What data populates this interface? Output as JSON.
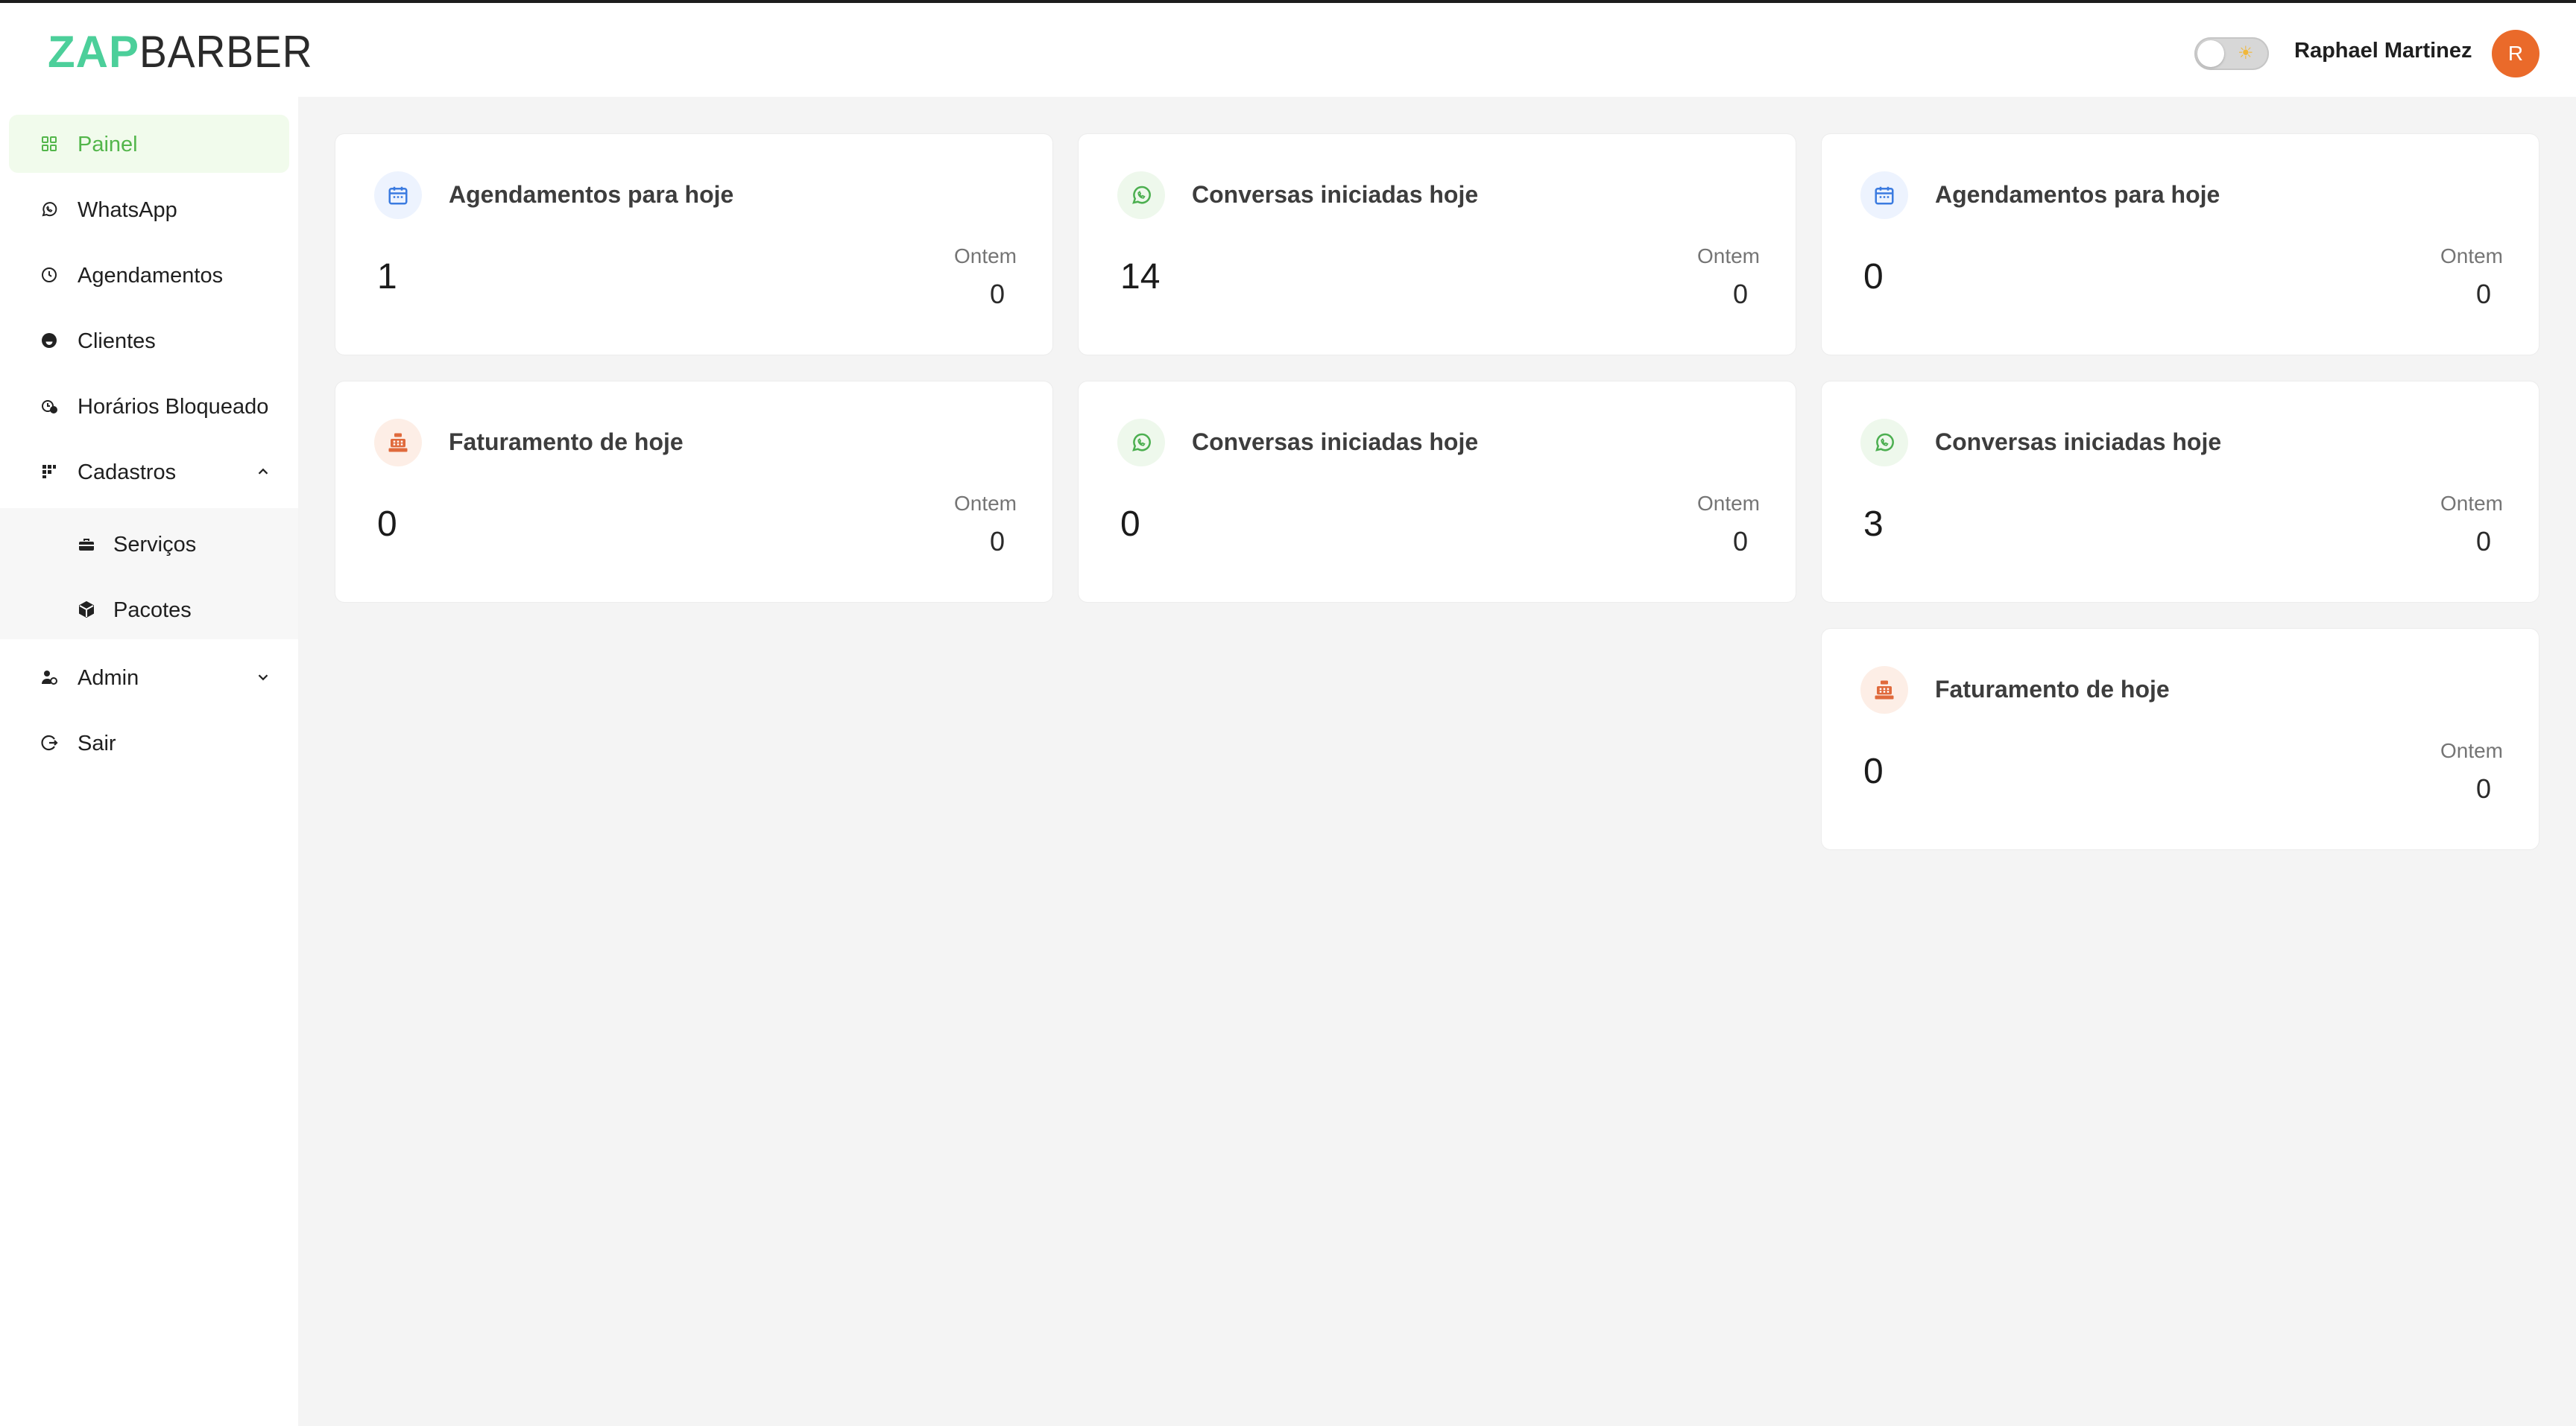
{
  "brand": {
    "part1": "ZAP",
    "part2": "BARBER"
  },
  "header": {
    "user_name": "Raphael Martinez",
    "avatar_initial": "R"
  },
  "sidebar": {
    "items": [
      {
        "label": "Painel",
        "icon": "grid-icon",
        "active": true
      },
      {
        "label": "WhatsApp",
        "icon": "whatsapp-icon"
      },
      {
        "label": "Agendamentos",
        "icon": "clock-icon"
      },
      {
        "label": "Clientes",
        "icon": "smile-icon"
      },
      {
        "label": "Horários Bloqueado",
        "icon": "block-clock-icon"
      },
      {
        "label": "Cadastros",
        "icon": "dots-grid-icon",
        "expanded": true
      },
      {
        "label": "Admin",
        "icon": "users-gear-icon",
        "expanded": false
      },
      {
        "label": "Sair",
        "icon": "logout-icon"
      }
    ],
    "cadastros_sub": [
      {
        "label": "Serviços",
        "icon": "toolbox-icon"
      },
      {
        "label": "Pacotes",
        "icon": "box-icon"
      }
    ]
  },
  "cards": [
    {
      "title": "Agendamentos para hoje",
      "value": "1",
      "prev_label": "Ontem",
      "prev_value": "0",
      "icon": "calendar-icon",
      "color": "blue"
    },
    {
      "title": "Conversas iniciadas hoje",
      "value": "14",
      "prev_label": "Ontem",
      "prev_value": "0",
      "icon": "whatsapp-icon",
      "color": "green"
    },
    {
      "title": "Agendamentos para hoje",
      "value": "0",
      "prev_label": "Ontem",
      "prev_value": "0",
      "icon": "calendar-icon",
      "color": "blue"
    },
    {
      "title": "Faturamento de hoje",
      "value": "0",
      "prev_label": "Ontem",
      "prev_value": "0",
      "icon": "cash-register-icon",
      "color": "orange"
    },
    {
      "title": "Conversas iniciadas hoje",
      "value": "0",
      "prev_label": "Ontem",
      "prev_value": "0",
      "icon": "whatsapp-icon",
      "color": "green"
    },
    {
      "title": "Conversas iniciadas hoje",
      "value": "3",
      "prev_label": "Ontem",
      "prev_value": "0",
      "icon": "whatsapp-icon",
      "color": "green"
    },
    {
      "title": "Faturamento de hoje",
      "value": "0",
      "prev_label": "Ontem",
      "prev_value": "0",
      "icon": "cash-register-icon",
      "color": "orange"
    }
  ],
  "colors": {
    "brand_green": "#4ccf9a",
    "active_green": "#53b64b",
    "avatar_orange": "#ea6a2a",
    "calendar_blue": "#3b7be0",
    "whatsapp_green": "#4caf50",
    "register_orange": "#e06a3c"
  }
}
